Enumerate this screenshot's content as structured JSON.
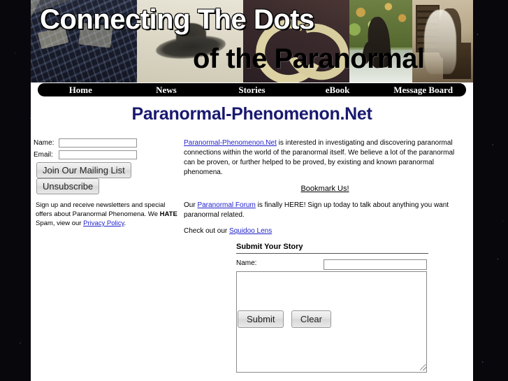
{
  "site": {
    "title": "Paranormal-Phenomenon.Net",
    "banner_line1": "Connecting The Dots",
    "banner_line2": "of the Paranormal",
    "title_color": "#191970",
    "link_color": "#2222cc"
  },
  "nav": {
    "items": [
      {
        "label": "Home"
      },
      {
        "label": "News"
      },
      {
        "label": "Stories"
      },
      {
        "label": "eBook"
      },
      {
        "label": "Message Board"
      }
    ]
  },
  "mailing_list": {
    "name_label": "Name:",
    "email_label": "Email:",
    "name_value": "",
    "email_value": "",
    "name_placeholder": "",
    "email_placeholder": "",
    "join_label": "Join Our Mailing List",
    "unsubscribe_label": "Unsubscribe",
    "disclaimer_pre": "Sign up and receive newsletters and special offers about Paranormal Phenomena. We ",
    "disclaimer_emphasis": "HATE",
    "disclaimer_mid": " Spam, view our ",
    "privacy_link": "Privacy Policy",
    "disclaimer_post": "."
  },
  "intro": {
    "link_text": "Paranormal-Phenomenon.Net",
    "body": " is interested in investigating and discovering paranormal connections within the world of the paranormal itself. We believe a lot of the paranormal can be proven, or further helped to be proved, by existing and known paranormal phenomena.",
    "bookmark_label": "Bookmark Us!",
    "forum_pre": "Our ",
    "forum_link": "Paranormal Forum",
    "forum_post": " is finally HERE! Sign up today to talk about anything you want paranormal related.",
    "squidoo_pre": "Check out our ",
    "squidoo_link": "Squidoo Lens"
  },
  "story_form": {
    "heading": "Submit Your Story",
    "name_label": "Name:",
    "name_value": "",
    "name_placeholder": "",
    "story_value": "",
    "story_placeholder": "",
    "submit_label": "Submit",
    "clear_label": "Clear"
  }
}
